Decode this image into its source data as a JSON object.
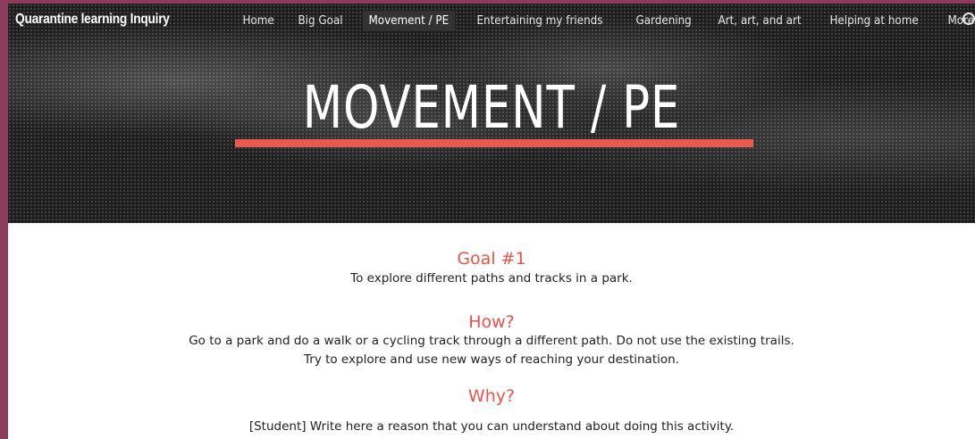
{
  "site": {
    "title": "Quarantine learning Inquiry"
  },
  "nav": {
    "items": [
      {
        "label": "Home",
        "active": false
      },
      {
        "label": "Big Goal",
        "active": false
      },
      {
        "label": "Movement / PE",
        "active": true
      },
      {
        "label": "Entertaining my friends",
        "active": false
      },
      {
        "label": "Gardening",
        "active": false
      },
      {
        "label": "Art, art, and art",
        "active": false
      },
      {
        "label": "Helping at home",
        "active": false
      }
    ],
    "more_label": "More",
    "more_icon": "chevron-down-icon",
    "search_icon": "search-icon"
  },
  "hero": {
    "title": "MOVEMENT / PE",
    "accent_color": "#e85a4f"
  },
  "content": {
    "goal_heading": "Goal #1",
    "goal_text": "To explore different paths and tracks in a park.",
    "how_heading": "How?",
    "how_line1": "Go to a park and do a walk or a cycling track through a different path. Do not use the existing trails.",
    "how_line2": "Try to explore and use new ways of reaching your destination.",
    "why_heading": "Why?",
    "why_text": "[Student] Write here a reason that you can understand about doing this activity."
  },
  "colors": {
    "frame": "#8e3a5c",
    "heading": "#e8554a"
  }
}
